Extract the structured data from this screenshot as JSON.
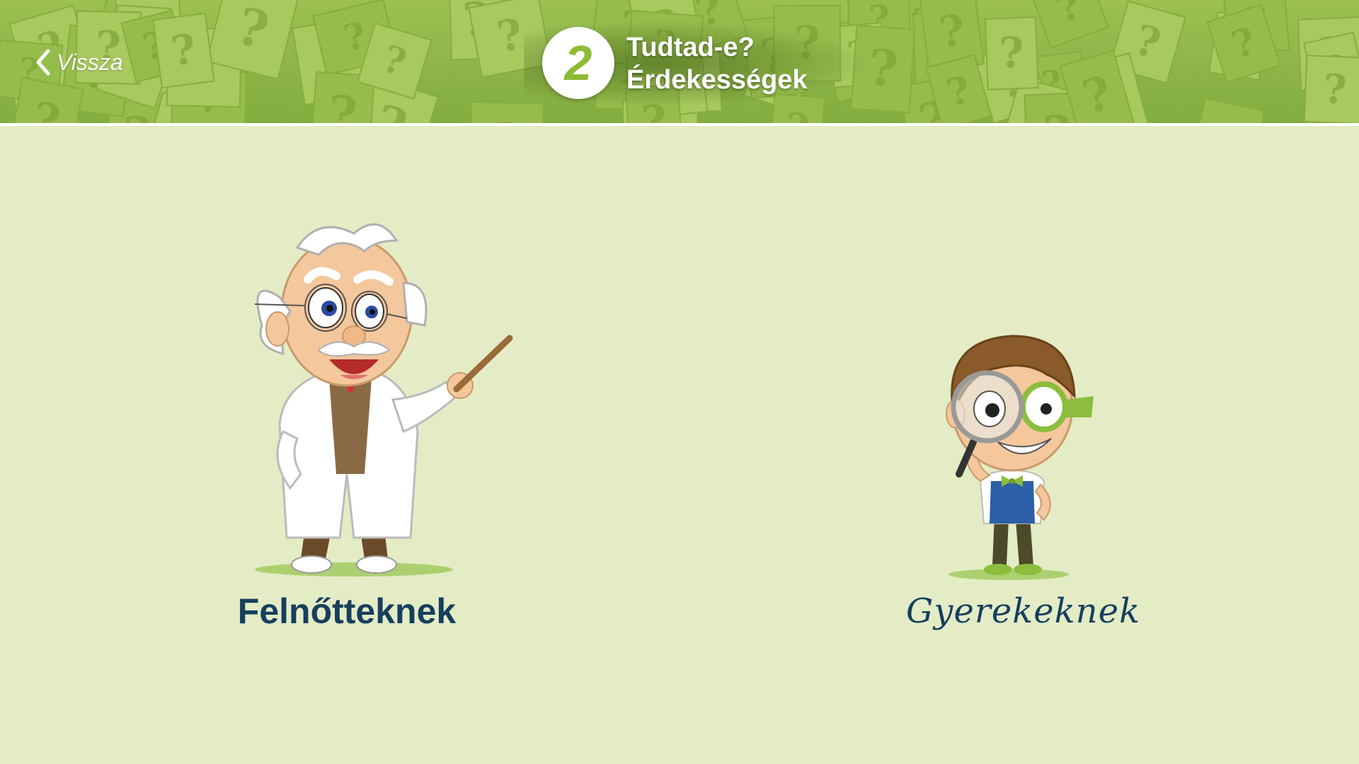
{
  "header": {
    "back_label": "Vissza",
    "number": "2",
    "title_line1": "Tudtad-e?",
    "title_line2": "Érdekességek",
    "accent_color": "#8dbb34"
  },
  "options": {
    "adults": {
      "label": "Felnőtteknek"
    },
    "kids": {
      "label": "Gyerekeknek"
    }
  },
  "colors": {
    "background": "#e4ecc6",
    "header_green": "#8db548",
    "label_text": "#163f5e"
  }
}
